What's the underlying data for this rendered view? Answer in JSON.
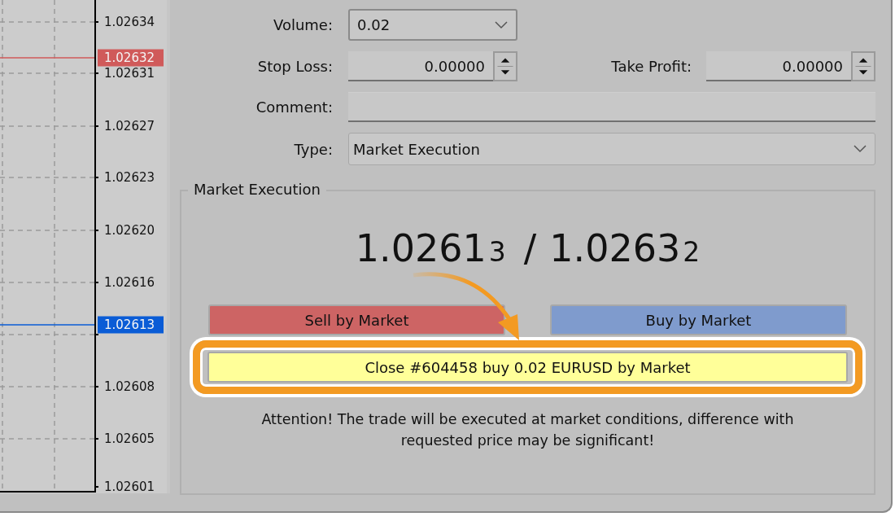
{
  "chart": {
    "axis_labels": [
      "1.02634",
      "1.02631",
      "1.02627",
      "1.02623",
      "1.02620",
      "1.02616",
      "1.02608",
      "1.02605",
      "1.02601"
    ],
    "markers": [
      {
        "price": "1.02632",
        "color": "#d05a5a"
      },
      {
        "price": "1.02613",
        "color": "#0a5cd6"
      }
    ]
  },
  "form": {
    "volume": {
      "label": "Volume:",
      "value": "0.02"
    },
    "stop_loss": {
      "label": "Stop Loss:",
      "value": "0.00000"
    },
    "take_profit": {
      "label": "Take Profit:",
      "value": "0.00000"
    },
    "comment": {
      "label": "Comment:"
    },
    "type": {
      "label": "Type:",
      "value": "Market Execution"
    }
  },
  "execution": {
    "title": "Market Execution",
    "quote": {
      "bid": {
        "digits": "1.0261",
        "last": "3"
      },
      "separator": "/",
      "ask": {
        "digits": "1.0263",
        "last": "2"
      }
    },
    "sell_button": "Sell by Market",
    "buy_button": "Buy by Market",
    "close_button": {
      "label": "Close  #604458 buy 0.02 EURUSD by Market",
      "highlighted": true
    },
    "warning": "Attention! The trade will be executed at market conditions, difference with requested price may be significant!"
  }
}
